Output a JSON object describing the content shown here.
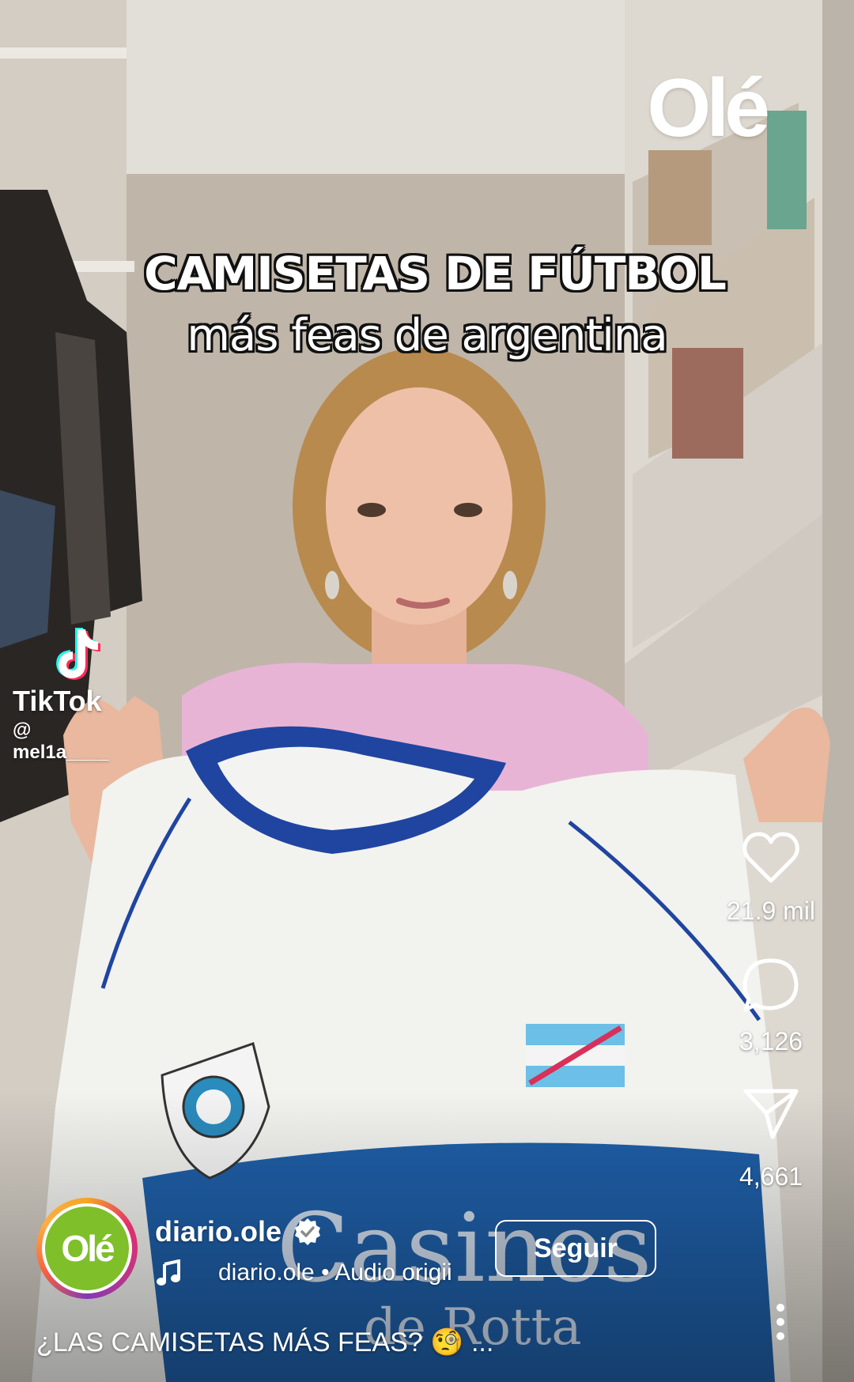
{
  "overlay": {
    "brand_watermark": "Olé",
    "caption_line1": "CAMISETAS DE FÚTBOL",
    "caption_line2": "más feas de argentina",
    "source_app": "TikTok",
    "source_handle": "@ mel1a____"
  },
  "actions": {
    "like_icon": "heart-icon",
    "like_count": "21.9 mil",
    "comment_icon": "comment-bubble-icon",
    "comment_count": "3,126",
    "share_icon": "paper-plane-icon",
    "share_count": "4,661",
    "more_icon": "more-vertical-icon"
  },
  "author": {
    "avatar_text": "Olé",
    "username": "diario.ole",
    "verified": true,
    "follow_label": "Seguir",
    "audio_label": "diario.ole • Audio origii"
  },
  "post": {
    "description": "¿LAS CAMISETAS MÁS FEAS? 🧐 ..."
  },
  "colors": {
    "ole_green": "#7fbf2a",
    "jersey_blue": "#1f5fa8",
    "shirt_pink": "#e8b4d6"
  }
}
